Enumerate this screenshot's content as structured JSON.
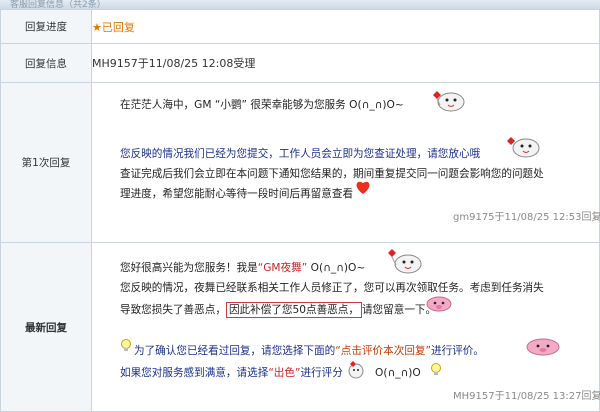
{
  "header": {
    "title": "客服回复信息（共2条）"
  },
  "rows": {
    "progress": {
      "label": "回复进度",
      "star": "★",
      "value": "已回复"
    },
    "info": {
      "label": "回复信息",
      "value": "MH9157于11/08/25 12:08受理"
    },
    "reply1": {
      "label": "第1次回复",
      "line1": "在茫茫人海中，GM “小鹦” 很荣幸能够为您服务  O(∩_∩)O~",
      "line2": "您反映的情况我们已经为您提交，工作人员会立即为您查证处理，请您放心哦",
      "line3": "查证完成后我们会立即在本问题下通知您结果的，期间重复提交同一问题会影响您的问题处",
      "line4": "理进度，希望您能耐心等待一段时间后再留意查看",
      "meta": "gm9175于11/08/25 12:53回复"
    },
    "reply2": {
      "label": "最新回复",
      "line1a": "您好很高兴能为您服务！我是",
      "line1b": "“GM夜舞”",
      "line1c": " O(∩_∩)O~",
      "line2": "您反映的情况，夜舞已经联系相关工作人员修正了，您可以再次领取任务。考虑到任务消失",
      "line3a": "导致您损失了善恶点，",
      "line3b": "因此补偿了您50点善恶点，",
      "line3c": "请您留意一下。",
      "line4a": "为了确认您已经看过回复，请您选择下面的",
      "line4b": "“点击评价本次回复”",
      "line4c": "进行评价。",
      "line5a": "如果您对服务感到满意，请选择",
      "line5b": "“出色”",
      "line5c": "进行评分",
      "line5d": "O(∩_∩)O",
      "meta": "MH9157于11/08/25 13:27回复"
    }
  },
  "colors": {
    "accent": "#e07a00",
    "link_blue": "#1a2f8c",
    "highlight_red": "#cc2222",
    "border": "#c9d4df"
  },
  "icons": [
    "sheep-mascot-icon",
    "heart-icon",
    "pig-mascot-icon",
    "lightbulb-icon",
    "smiley-icon"
  ]
}
